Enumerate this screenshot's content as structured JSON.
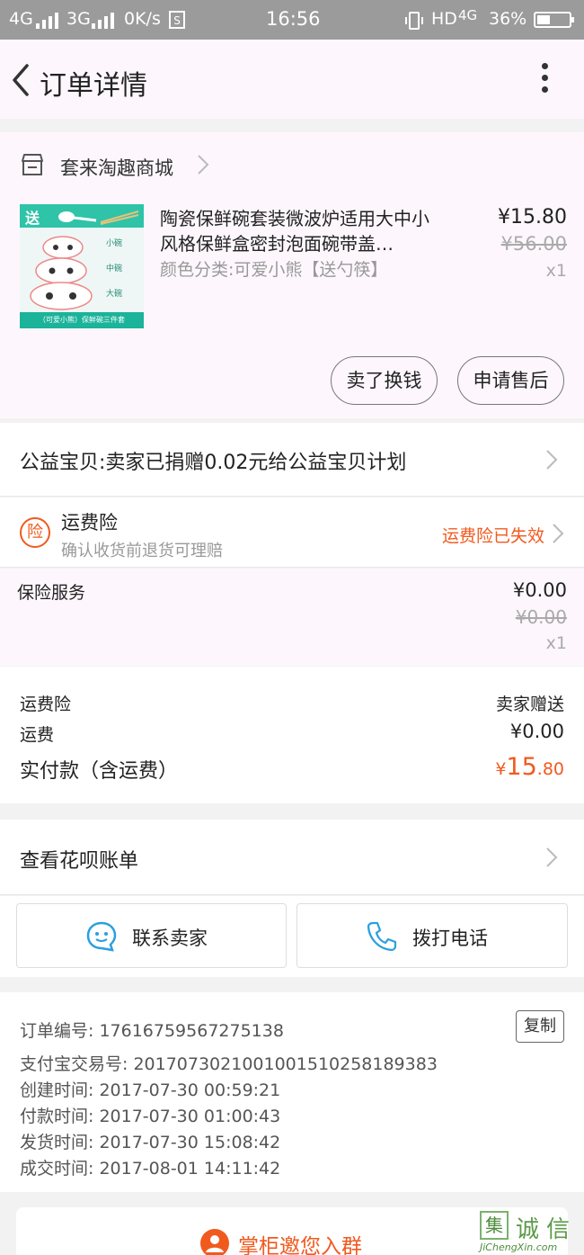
{
  "status_bar": {
    "net1": "4G",
    "net2": "3G",
    "speed": "0K/s",
    "time": "16:56",
    "hd": "HD",
    "net3": "4G",
    "battery": "36%"
  },
  "header": {
    "title": "订单详情"
  },
  "shop": {
    "name": "套来淘趣商城"
  },
  "product": {
    "title": "陶瓷保鲜碗套装微波炉适用大中小风格保鲜盒密封泡面碗带盖…",
    "variant": "颜色分类:可爱小熊【送勺筷】",
    "price": "¥15.80",
    "original_price": "¥56.00",
    "quantity": "x1",
    "thumb_label_top": "送",
    "thumb_sizes": [
      "小碗",
      "中碗",
      "大碗"
    ],
    "thumb_caption": "（可爱小熊）保鲜碗三件套"
  },
  "actions": {
    "resell": "卖了换钱",
    "after_sale": "申请售后"
  },
  "charity": {
    "text": "公益宝贝:卖家已捐赠0.02元给公益宝贝计划"
  },
  "shipping_insurance": {
    "badge": "险",
    "title": "运费险",
    "subtitle": "确认收货前退货可理赔",
    "status": "运费险已失效"
  },
  "insurance_service": {
    "label": "保险服务",
    "price": "¥0.00",
    "original_price": "¥0.00",
    "quantity": "x1"
  },
  "fees": {
    "ins_label": "运费险",
    "ins_value": "卖家赠送",
    "shipping_label": "运费",
    "shipping_value": "¥0.00",
    "total_label": "实付款（含运费）",
    "total_currency": "¥",
    "total_int": "15",
    "total_dec": ".80"
  },
  "huabei": {
    "text": "查看花呗账单"
  },
  "contact": {
    "seller": "联系卖家",
    "call": "拨打电话"
  },
  "order_info": {
    "order_no": "订单编号: 17616759567275138",
    "copy": "复制",
    "alipay_no": "支付宝交易号: 2017073021001001510258189383",
    "created": "创建时间: 2017-07-30 00:59:21",
    "paid": "付款时间: 2017-07-30 01:00:43",
    "shipped": "发货时间: 2017-07-30 15:08:42",
    "closed": "成交时间: 2017-08-01 14:11:42"
  },
  "group_banner": {
    "text": "掌柜邀您入群"
  },
  "watermark": {
    "box": "集",
    "c1": "诚",
    "c2": "信",
    "url": "JiChengXin.com"
  },
  "colors": {
    "accent": "#f05a1e",
    "status_bar": "#9b9b9b",
    "card_bg": "#fdf7fd",
    "icon_blue": "#2a9fe0"
  }
}
